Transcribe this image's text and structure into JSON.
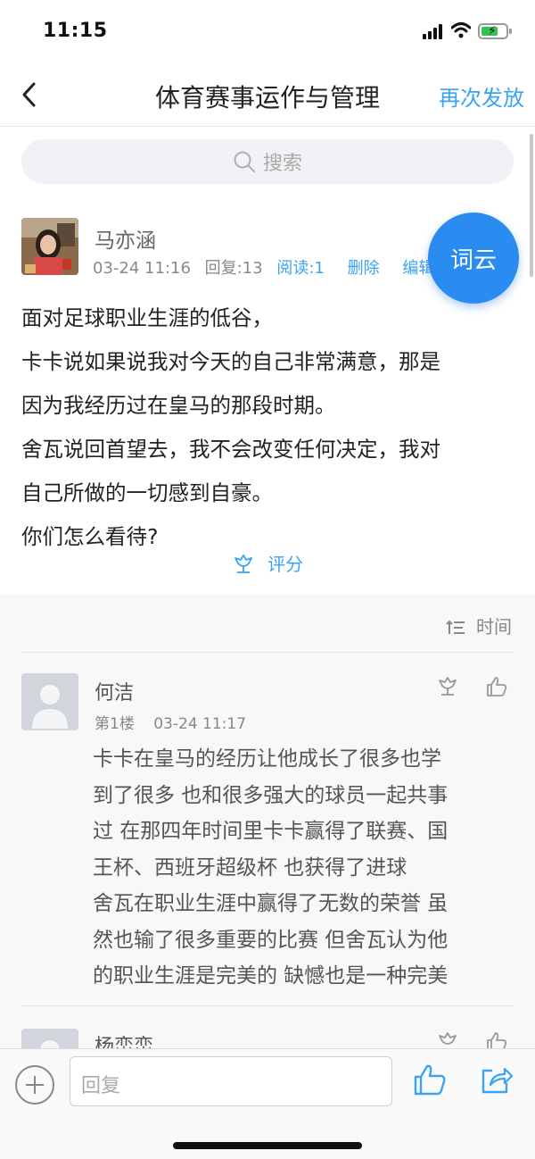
{
  "status": {
    "time": "11:15",
    "icons": [
      "signal-icon",
      "wifi-icon",
      "battery-charging-icon"
    ]
  },
  "nav": {
    "back_icon": "chevron-left-icon",
    "title": "体育赛事运作与管理",
    "action": "再次发放"
  },
  "search": {
    "icon": "search-icon",
    "placeholder": "搜索"
  },
  "post": {
    "author": "马亦涵",
    "date": "03-24 11:16",
    "replies": "回复:13",
    "reads": "阅读:1",
    "delete": "删除",
    "edit": "编辑",
    "lines": [
      "面对足球职业生涯的低谷，",
      "卡卡说如果说我对今天的自己非常满意，那是",
      "因为我经历过在皇马的那段时期。",
      "舍瓦说回首望去，我不会改变任何决定，我对",
      "自己所做的一切感到自豪。",
      "你们怎么看待?"
    ],
    "rate_label": "评分",
    "rate_icon": "flower-icon"
  },
  "fab": {
    "label": "词云"
  },
  "sort": {
    "icon": "sort-icon",
    "label": "时间"
  },
  "replies": [
    {
      "name": "何洁",
      "floor": "第1楼",
      "date": "03-24 11:17",
      "lines": [
        "卡卡在皇马的经历让他成长了很多也学",
        "到了很多 也和很多强大的球员一起共事",
        "过 在那四年时间里卡卡赢得了联赛、国",
        "王杯、西班牙超级杯 也获得了进球",
        "舍瓦在职业生涯中赢得了无数的荣誉 虽",
        "然也输了很多重要的比赛 但舍瓦认为他",
        "的职业生涯是完美的 缺憾也是一种完美"
      ]
    },
    {
      "name": "杨峦峦"
    }
  ],
  "bottom": {
    "plus_icon": "plus-circle-icon",
    "reply_placeholder": "回复",
    "like_icon": "thumbs-up-icon",
    "share_icon": "share-icon"
  },
  "colors": {
    "accent": "#3aa3f2",
    "fab": "#2a8cf0",
    "battery": "#33c24d"
  }
}
